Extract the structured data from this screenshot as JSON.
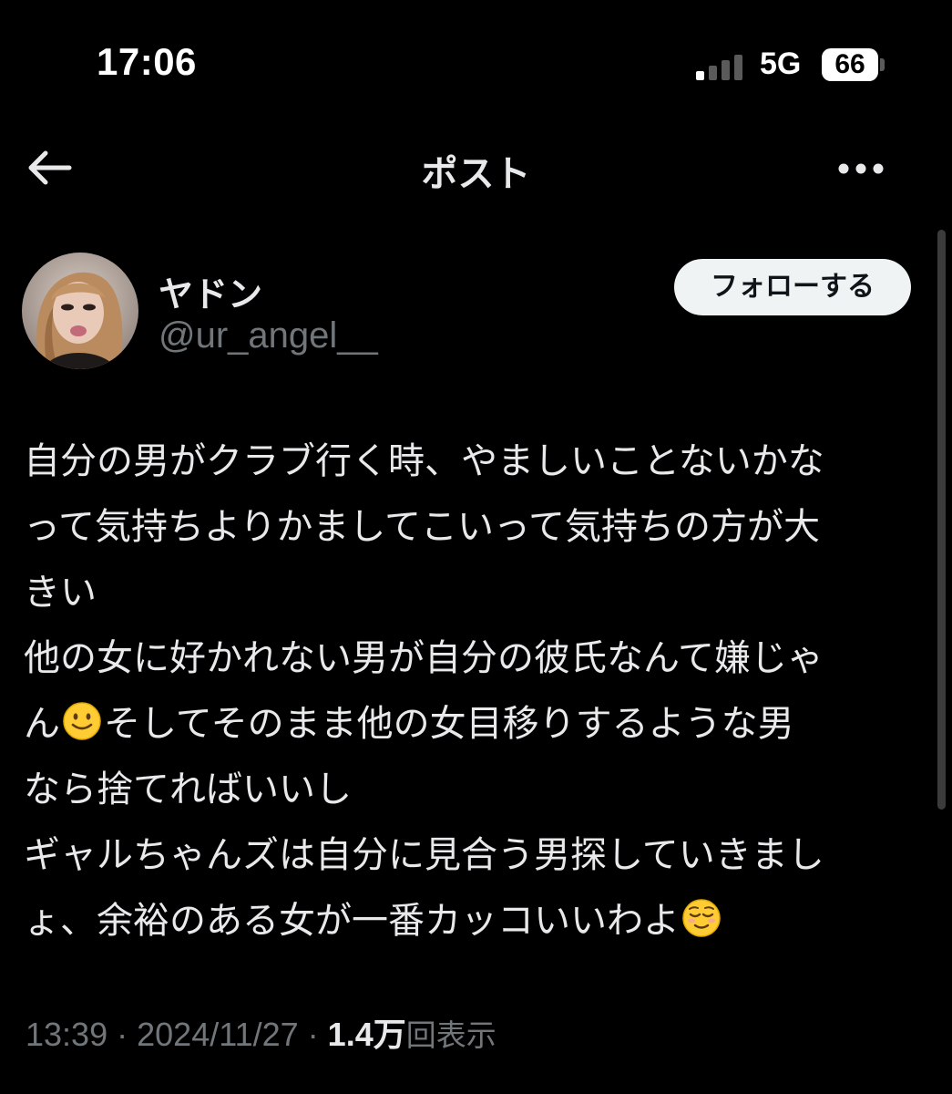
{
  "status_bar": {
    "time": "17:06",
    "network": "5G",
    "battery": "66",
    "signal_bars_on": 1,
    "signal_bars_total": 4
  },
  "header": {
    "title": "ポスト",
    "back_icon": "arrow-left-icon",
    "more_icon": "more-horizontal-icon"
  },
  "author": {
    "display_name": "ヤドン",
    "handle": "@ur_angel__",
    "follow_label": "フォローする"
  },
  "post": {
    "lines": [
      "自分の男がクラブ行く時、やましいことないかな",
      "って気持ちよりかましてこいって気持ちの方が大",
      "きい",
      "他の女に好かれない男が自分の彼氏なんて嫌じゃ",
      "ん",
      "そしてそのまま他の女目移りするような男",
      "なら捨てればいいし",
      "ギャルちゃんズは自分に見合う男探していきまし",
      "ょ、余裕のある女が一番カッコいいわよ"
    ],
    "emojis": [
      "slightly-smiling-face-emoji",
      "relieved-face-emoji"
    ]
  },
  "meta": {
    "time": "13:39",
    "separator": "·",
    "date": "2024/11/27",
    "views_count": "1.4",
    "views_unit": "万",
    "views_label": "回表示"
  },
  "colors": {
    "background": "#000000",
    "text": "#e7e9ea",
    "secondary_text": "#71767b",
    "follow_button_bg": "#eff3f4"
  }
}
